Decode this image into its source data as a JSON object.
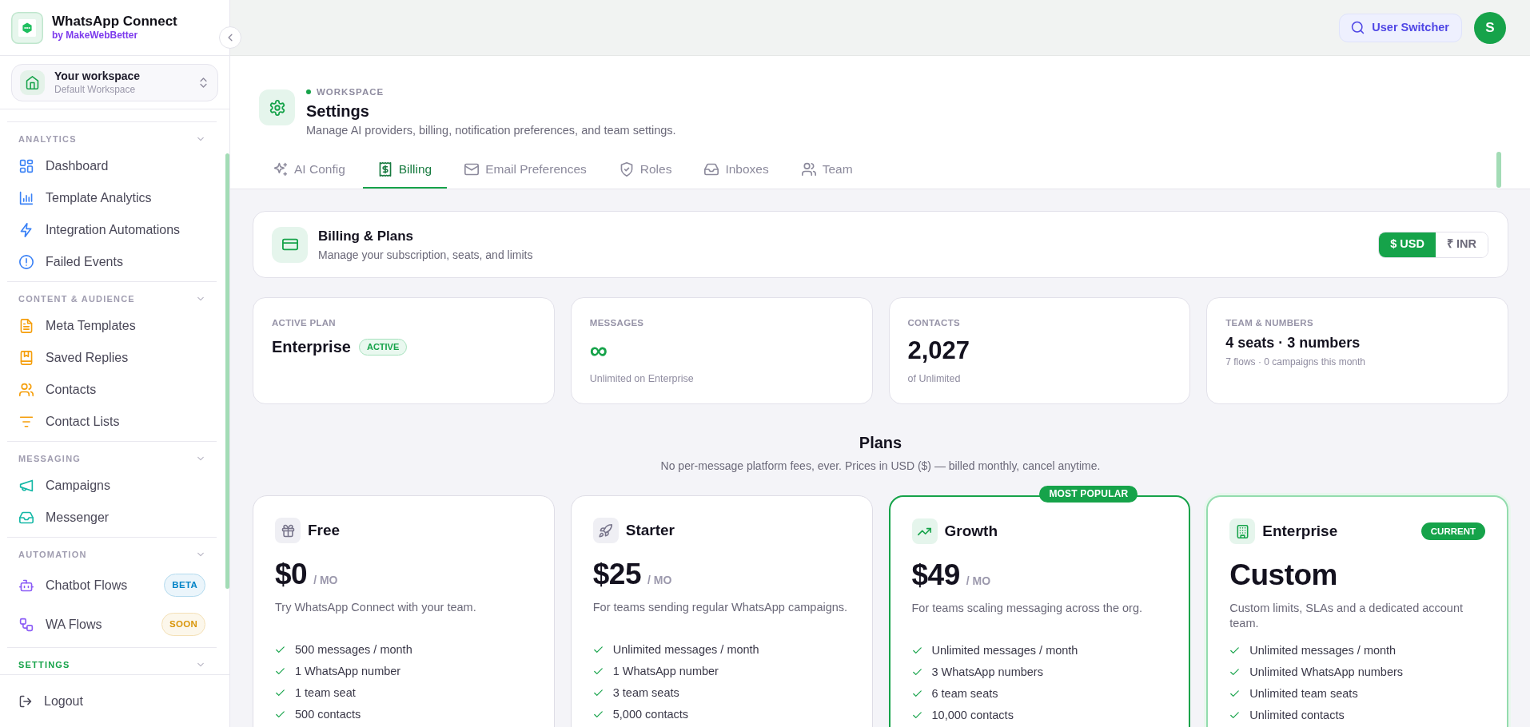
{
  "sidebar": {
    "brand": {
      "name": "WhatsApp Connect",
      "byline": "by MakeWebBetter"
    },
    "workspace": {
      "label": "Your workspace",
      "name": "Default Workspace"
    },
    "sections": [
      {
        "title": "ANALYTICS",
        "active": false,
        "expanded": true,
        "color": "#3b82f6",
        "items": [
          {
            "label": "Dashboard"
          },
          {
            "label": "Template Analytics"
          },
          {
            "label": "Integration Automations"
          },
          {
            "label": "Failed Events"
          }
        ]
      },
      {
        "title": "CONTENT & AUDIENCE",
        "active": false,
        "expanded": true,
        "color": "#f59e0b",
        "items": [
          {
            "label": "Meta Templates"
          },
          {
            "label": "Saved Replies"
          },
          {
            "label": "Contacts"
          },
          {
            "label": "Contact Lists"
          }
        ]
      },
      {
        "title": "MESSAGING",
        "active": false,
        "expanded": true,
        "color": "#14b8a6",
        "items": [
          {
            "label": "Campaigns"
          },
          {
            "label": "Messenger"
          }
        ]
      },
      {
        "title": "AUTOMATION",
        "active": false,
        "expanded": true,
        "color": "#8b5cf6",
        "items": [
          {
            "label": "Chatbot Flows",
            "badge": {
              "text": "BETA",
              "color": "#0284c7"
            }
          },
          {
            "label": "WA Flows",
            "badge": {
              "text": "SOON",
              "color": "#d9960a"
            }
          }
        ]
      },
      {
        "title": "SETTINGS",
        "active": true,
        "expanded": true
      }
    ],
    "logout": "Logout"
  },
  "topbar": {
    "user_switcher": "User Switcher",
    "avatar": "S"
  },
  "header": {
    "eyebrow": "WORKSPACE",
    "title": "Settings",
    "description": "Manage AI providers, billing, notification preferences, and team settings."
  },
  "tabs": [
    {
      "label": "AI Config",
      "selected": false
    },
    {
      "label": "Billing",
      "selected": true
    },
    {
      "label": "Email Preferences",
      "selected": false
    },
    {
      "label": "Roles",
      "selected": false
    },
    {
      "label": "Inboxes",
      "selected": false
    },
    {
      "label": "Team",
      "selected": false
    }
  ],
  "billing": {
    "title": "Billing & Plans",
    "description": "Manage your subscription, seats, and limits",
    "currencies": [
      {
        "label": "$ USD",
        "selected": true
      },
      {
        "label": "₹ INR",
        "selected": false
      }
    ]
  },
  "stats": [
    {
      "kind": "plan",
      "label": "ACTIVE PLAN",
      "value": "Enterprise",
      "badge": "ACTIVE"
    },
    {
      "kind": "unlimited",
      "label": "MESSAGES",
      "value": "∞",
      "note": "Unlimited on Enterprise"
    },
    {
      "kind": "metric",
      "label": "CONTACTS",
      "value": "2,027",
      "note": "of Unlimited"
    },
    {
      "kind": "summary",
      "label": "TEAM & NUMBERS",
      "value": "4 seats · 3 numbers",
      "note": "7 flows · 0 campaigns this month"
    }
  ],
  "plans": {
    "title": "Plans",
    "subtitle": "No per-message platform fees, ever. Prices in USD ($) — billed monthly, cancel anytime.",
    "items": [
      {
        "name": "Free",
        "price": "$0",
        "period": "/ MO",
        "description": "Try WhatsApp Connect with your team.",
        "featured": false,
        "current": false,
        "features": [
          "500 messages / month",
          "1 WhatsApp number",
          "1 team seat",
          "500 contacts"
        ]
      },
      {
        "name": "Starter",
        "price": "$25",
        "period": "/ MO",
        "description": "For teams sending regular WhatsApp campaigns.",
        "featured": false,
        "current": false,
        "features": [
          "Unlimited messages / month",
          "1 WhatsApp number",
          "3 team seats",
          "5,000 contacts"
        ]
      },
      {
        "name": "Growth",
        "price": "$49",
        "period": "/ MO",
        "description": "For teams scaling messaging across the org.",
        "featured": true,
        "current": false,
        "ribbon": "MOST POPULAR",
        "features": [
          "Unlimited messages / month",
          "3 WhatsApp numbers",
          "6 team seats",
          "10,000 contacts"
        ]
      },
      {
        "name": "Enterprise",
        "price": "Custom",
        "description": "Custom limits, SLAs and a dedicated account team.",
        "featured": false,
        "current": true,
        "badge": "CURRENT",
        "features": [
          "Unlimited messages / month",
          "Unlimited WhatsApp numbers",
          "Unlimited team seats",
          "Unlimited contacts"
        ]
      }
    ]
  }
}
